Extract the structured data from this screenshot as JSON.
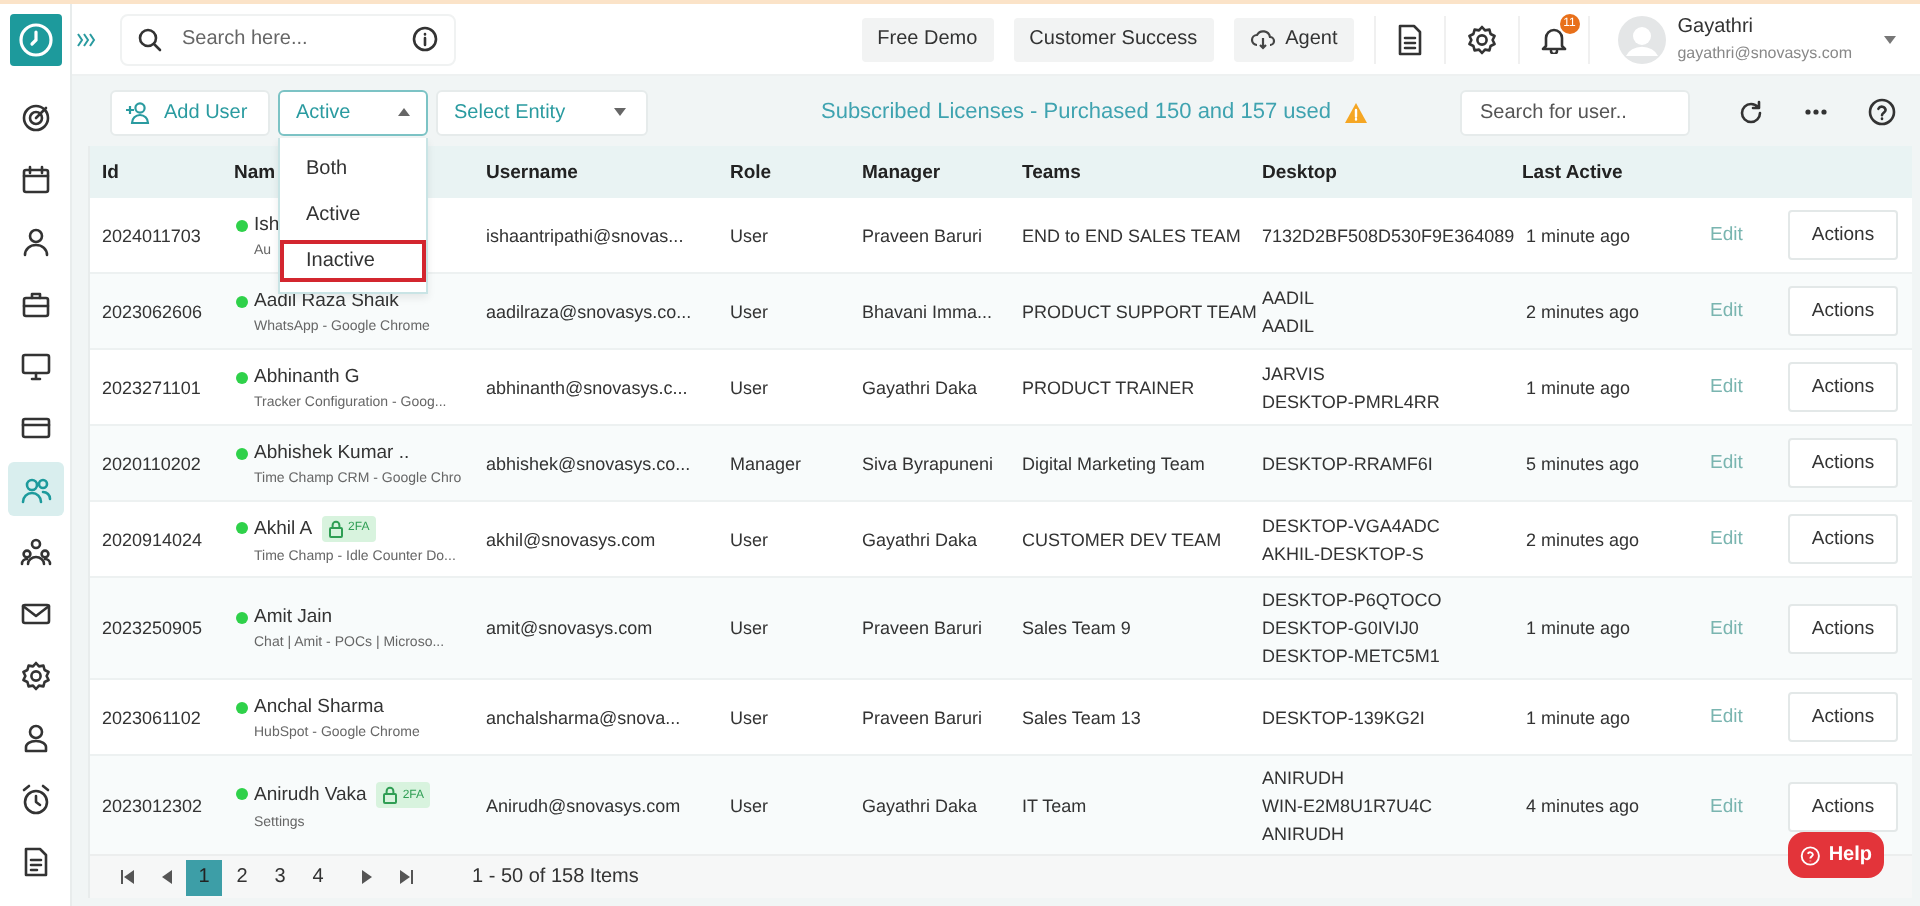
{
  "header": {
    "search_placeholder": "Search here...",
    "buttons": [
      {
        "label": "Free Demo",
        "kind": "plain"
      },
      {
        "label": "Customer Success",
        "kind": "plain"
      },
      {
        "label": "Agent",
        "kind": "cloud"
      }
    ],
    "notifications": "11",
    "user": {
      "name": "Gayathri",
      "email": "gayathri@snovasys.com"
    }
  },
  "sidebar": {
    "items": [
      {
        "selected": false
      },
      {
        "selected": false
      },
      {
        "selected": false
      },
      {
        "selected": false
      },
      {
        "selected": false
      },
      {
        "selected": false
      },
      {
        "selected": true
      },
      {
        "selected": false
      },
      {
        "selected": false
      },
      {
        "selected": false
      },
      {
        "selected": false
      },
      {
        "selected": false
      },
      {
        "selected": false
      }
    ]
  },
  "toolbar": {
    "add_user": "Add User",
    "status_filter": {
      "value": "Active",
      "expanded": true,
      "options": [
        {
          "label": "Both",
          "highlighted": false
        },
        {
          "label": "Active",
          "highlighted": false
        },
        {
          "label": "Inactive",
          "highlighted": true
        }
      ]
    },
    "entity_placeholder": "Select Entity",
    "license_notice": "Subscribed Licenses - Purchased 150 and 157 used",
    "search_placeholder": "Search for user.."
  },
  "table": {
    "columns": [
      "Id",
      "Nam",
      "Username",
      "Role",
      "Manager",
      "Teams",
      "Desktop",
      "Last Active"
    ],
    "rows": [
      {
        "id": "2024011703",
        "name": "Ish",
        "online": true,
        "app": "Au",
        "username": "ishaantripathi@snovas...",
        "role": "User",
        "manager": "Praveen Baruri",
        "team": "END to END SALES TEAM",
        "desktops": [
          "7132D2BF508D530F9E364089"
        ],
        "last_active": "1 minute ago",
        "edit": "Edit",
        "action": "Actions"
      },
      {
        "id": "2023062606",
        "name": "Aadil Raza Shaik",
        "online": true,
        "app": "WhatsApp - Google Chrome",
        "username": "aadilraza@snovasys.co...",
        "role": "User",
        "manager": "Bhavani Imma...",
        "team": "PRODUCT SUPPORT TEAM",
        "desktops": [
          "AADIL",
          "AADIL"
        ],
        "last_active": "2 minutes ago",
        "edit": "Edit",
        "action": "Actions"
      },
      {
        "id": "2023271101",
        "name": "Abhinanth G",
        "online": true,
        "app": "Tracker Configuration - Goog...",
        "username": "abhinanth@snovasys.c...",
        "role": "User",
        "manager": "Gayathri Daka",
        "team": "PRODUCT TRAINER",
        "desktops": [
          "JARVIS",
          "DESKTOP-PMRL4RR"
        ],
        "last_active": "1 minute ago",
        "edit": "Edit",
        "action": "Actions"
      },
      {
        "id": "2020110202",
        "name": "Abhishek Kumar ..",
        "online": true,
        "app": "Time Champ CRM - Google Chro",
        "username": "abhishek@snovasys.co...",
        "role": "Manager",
        "manager": "Siva Byrapuneni",
        "team": "Digital Marketing Team",
        "desktops": [
          "DESKTOP-RRAMF6I"
        ],
        "last_active": "5 minutes ago",
        "edit": "Edit",
        "action": "Actions"
      },
      {
        "id": "2020914024",
        "name": "Akhil A",
        "online": true,
        "badge": "2FA",
        "app": "Time Champ - Idle Counter Do...",
        "username": "akhil@snovasys.com",
        "role": "User",
        "manager": "Gayathri Daka",
        "team": "CUSTOMER DEV TEAM",
        "desktops": [
          "DESKTOP-VGA4ADC",
          "AKHIL-DESKTOP-S"
        ],
        "last_active": "2 minutes ago",
        "edit": "Edit",
        "action": "Actions"
      },
      {
        "id": "2023250905",
        "name": "Amit Jain",
        "online": true,
        "app": "Chat | Amit - POCs | Microso...",
        "username": "amit@snovasys.com",
        "role": "User",
        "manager": "Praveen Baruri",
        "team": "Sales Team 9",
        "desktops": [
          "DESKTOP-P6QTOCO",
          "DESKTOP-G0IVIJ0",
          "DESKTOP-METC5M1"
        ],
        "last_active": "1 minute ago",
        "edit": "Edit",
        "action": "Actions"
      },
      {
        "id": "2023061102",
        "name": "Anchal Sharma",
        "online": true,
        "app": "HubSpot - Google Chrome",
        "username": "anchalsharma@snova...",
        "role": "User",
        "manager": "Praveen Baruri",
        "team": "Sales Team 13",
        "desktops": [
          "DESKTOP-139KG2I"
        ],
        "last_active": "1 minute ago",
        "edit": "Edit",
        "action": "Actions"
      },
      {
        "id": "2023012302",
        "name": "Anirudh Vaka",
        "online": true,
        "badge": "2FA",
        "app": "Settings",
        "username": "Anirudh@snovasys.com",
        "role": "User",
        "manager": "Gayathri Daka",
        "team": "IT Team",
        "desktops": [
          "ANIRUDH",
          "WIN-E2M8U1R7U4C",
          "ANIRUDH"
        ],
        "last_active": "4 minutes ago",
        "edit": "Edit",
        "action": "Actions"
      }
    ]
  },
  "pagination": {
    "pages": [
      {
        "label": "1",
        "selected": true
      },
      {
        "label": "2",
        "selected": false
      },
      {
        "label": "3",
        "selected": false
      },
      {
        "label": "4",
        "selected": false
      }
    ],
    "summary": "1 - 50 of 158 Items"
  },
  "help": "Help"
}
